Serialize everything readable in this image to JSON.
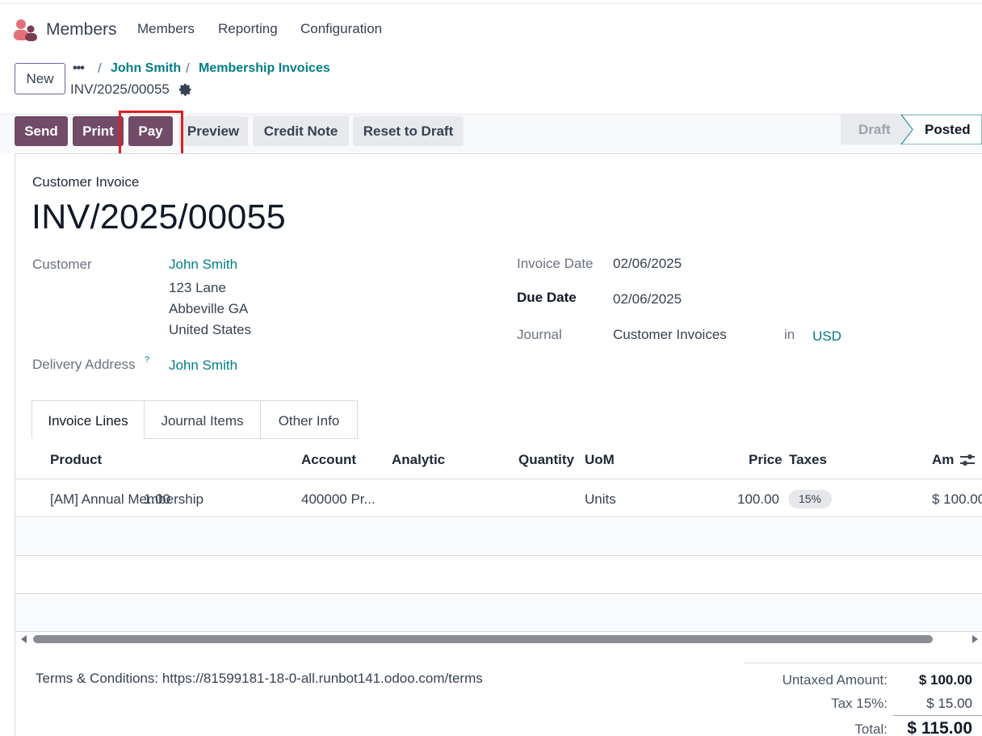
{
  "app": {
    "name": "Members"
  },
  "menu": [
    "Members",
    "Reporting",
    "Configuration"
  ],
  "control": {
    "new_label": "New",
    "breadcrumb": {
      "dots": "•••",
      "items": [
        "John Smith",
        "Membership Invoices"
      ]
    },
    "record_name": "INV/2025/00055"
  },
  "actions": {
    "send": "Send",
    "print": "Print",
    "pay": "Pay",
    "preview": "Preview",
    "credit_note": "Credit Note",
    "reset_to_draft": "Reset to Draft"
  },
  "status": {
    "draft": "Draft",
    "posted": "Posted",
    "current": "Posted"
  },
  "invoice": {
    "type_label": "Customer Invoice",
    "number": "INV/2025/00055",
    "customer_label": "Customer",
    "customer_name": "John Smith",
    "address_line1": "123 Lane",
    "address_line2": "Abbeville GA",
    "address_line3": "United States",
    "delivery_label": "Delivery Address",
    "delivery_help": "?",
    "delivery_name": "John Smith",
    "invoice_date_label": "Invoice Date",
    "invoice_date": "02/06/2025",
    "due_date_label": "Due Date",
    "due_date": "02/06/2025",
    "journal_label": "Journal",
    "journal": "Customer Invoices",
    "in_label": "in",
    "currency": "USD"
  },
  "tabs": [
    "Invoice Lines",
    "Journal Items",
    "Other Info"
  ],
  "lines": {
    "headers": {
      "product": "Product",
      "account": "Account",
      "analytic": "Analytic",
      "quantity": "Quantity",
      "uom": "UoM",
      "price": "Price",
      "taxes": "Taxes",
      "amount": "Am"
    },
    "rows": [
      {
        "product": "[AM] Annual Membership",
        "account": "400000 Pr...",
        "analytic": "",
        "quantity": "1.00",
        "uom": "Units",
        "price": "100.00",
        "tax": "15%",
        "amount": "$ 100.00"
      }
    ]
  },
  "terms": "Terms & Conditions: https://81599181-18-0-all.runbot141.odoo.com/terms",
  "totals": {
    "untaxed_label": "Untaxed Amount:",
    "untaxed_value": "$ 100.00",
    "tax_label": "Tax 15%:",
    "tax_value": "$ 15.00",
    "total_label": "Total:",
    "total_value": "$ 115.00"
  },
  "colors": {
    "primary": "#714b67",
    "link": "#017e84",
    "highlight": "#e02020"
  },
  "icons": [
    "members-app-icon",
    "gear-icon",
    "optional-columns-icon",
    "scroll-left-icon",
    "scroll-right-icon"
  ]
}
